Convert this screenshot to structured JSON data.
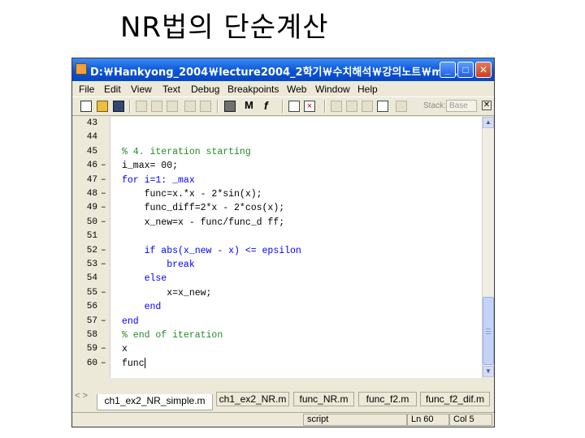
{
  "slide": {
    "title": "NR법의 단순계산"
  },
  "window": {
    "title": "D:￦Hankyong_2004￦lecture2004_2학기￦수치해석￦강의노트￦ma...",
    "controls": {
      "minimize": "_",
      "maximize": "□",
      "close": "✕"
    }
  },
  "menu": [
    "File",
    "Edit",
    "View",
    "Text",
    "Debug",
    "Breakpoints",
    "Web",
    "Window",
    "Help"
  ],
  "toolbar": {
    "stack_label": "Stack:",
    "stack_value": "Base",
    "close_glyph": "✕",
    "find_glyph": "M",
    "func_glyph": "f"
  },
  "editor": {
    "lines": [
      {
        "num": "43",
        "marker": "",
        "text": "",
        "style": ""
      },
      {
        "num": "44",
        "marker": "",
        "text": "",
        "style": ""
      },
      {
        "num": "45",
        "marker": "",
        "text": "% 4. iteration starting",
        "style": "cm"
      },
      {
        "num": "46",
        "marker": "–",
        "text": "i_max= 00;",
        "style": ""
      },
      {
        "num": "47",
        "marker": "–",
        "text": "for i=1: _max",
        "style": "kw"
      },
      {
        "num": "48",
        "marker": "–",
        "text": "    func=x.*x - 2*sin(x);",
        "style": ""
      },
      {
        "num": "49",
        "marker": "–",
        "text": "    func_diff=2*x - 2*cos(x);",
        "style": ""
      },
      {
        "num": "50",
        "marker": "–",
        "text": "    x_new=x - func/func_d ff;",
        "style": ""
      },
      {
        "num": "51",
        "marker": "",
        "text": "",
        "style": ""
      },
      {
        "num": "52",
        "marker": "–",
        "text": "    if abs(x_new - x) <= epsilon",
        "style": "kw"
      },
      {
        "num": "53",
        "marker": "–",
        "text": "        break",
        "style": "kw"
      },
      {
        "num": "54",
        "marker": "",
        "text": "    else",
        "style": "kw"
      },
      {
        "num": "55",
        "marker": "–",
        "text": "        x=x_new;",
        "style": ""
      },
      {
        "num": "56",
        "marker": "",
        "text": "    end",
        "style": "kw"
      },
      {
        "num": "57",
        "marker": "–",
        "text": "end",
        "style": "kw"
      },
      {
        "num": "58",
        "marker": "",
        "text": "% end of iteration",
        "style": "cm"
      },
      {
        "num": "59",
        "marker": "–",
        "text": "x",
        "style": ""
      },
      {
        "num": "60",
        "marker": "–",
        "text": "func",
        "style": ""
      }
    ],
    "scroll_up": "▲",
    "scroll_down": "▼"
  },
  "tabs": {
    "scroll": "< >",
    "items": [
      {
        "label": "ch1_ex2_NR_simple.m",
        "active": true
      },
      {
        "label": "ch1_ex2_NR.m",
        "active": false
      },
      {
        "label": "func_NR.m",
        "active": false
      },
      {
        "label": "func_f2.m",
        "active": false
      },
      {
        "label": "func_f2_dif.m",
        "active": false
      }
    ]
  },
  "status": {
    "mode": "script",
    "line": "Ln 60",
    "col": "Col 5"
  },
  "colors": {
    "titlebar": "#0a54d8",
    "keyword": "#0000ff",
    "comment": "#228b22",
    "chrome": "#ece9d8"
  }
}
